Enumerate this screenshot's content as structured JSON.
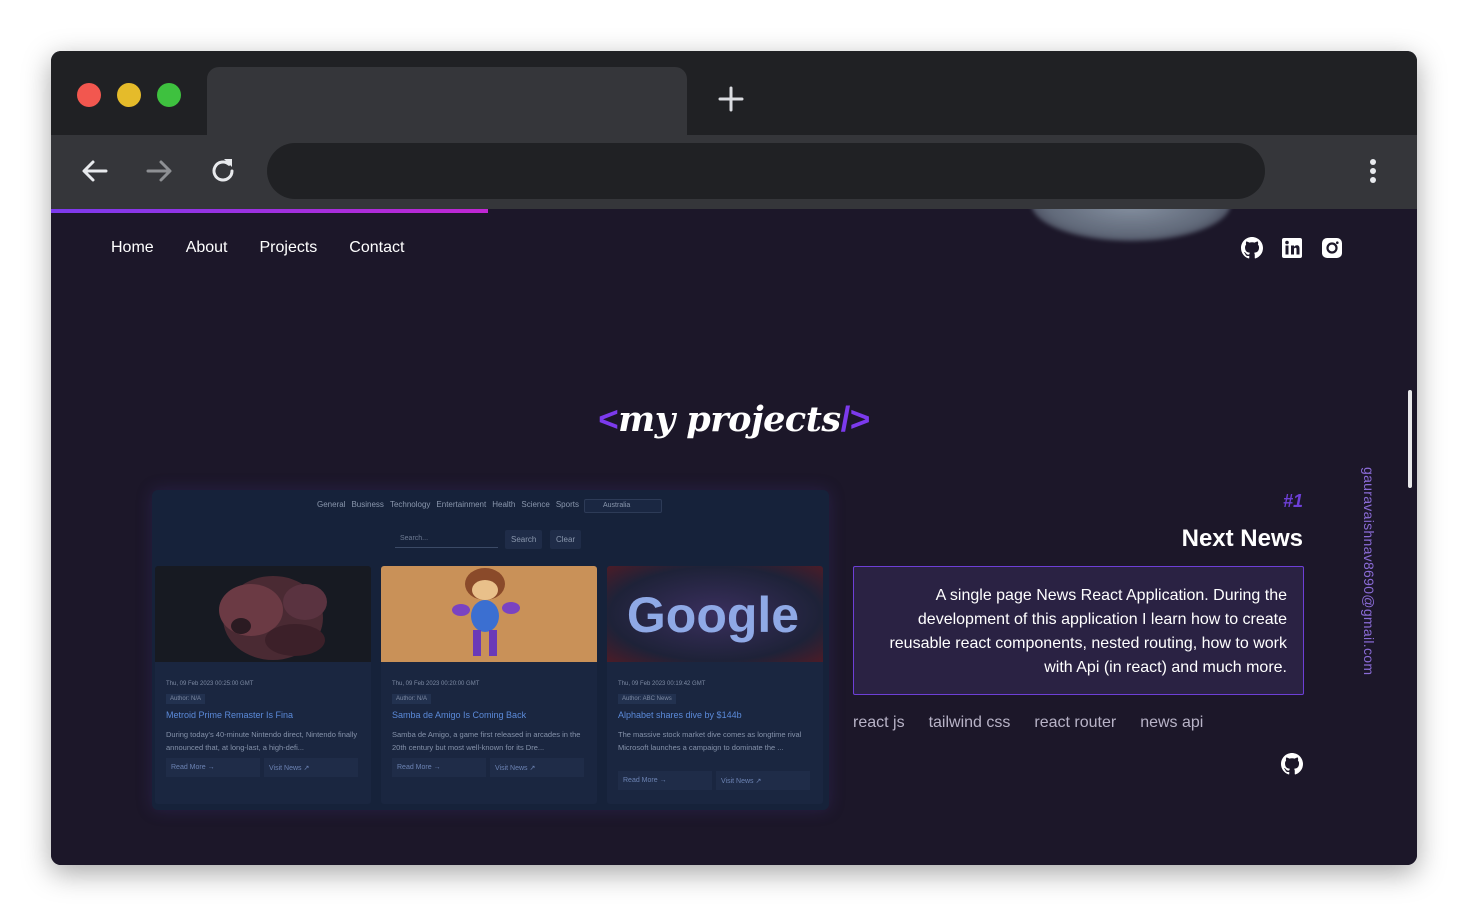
{
  "nav": {
    "items": [
      {
        "label": "Home"
      },
      {
        "label": "About"
      },
      {
        "label": "Projects"
      },
      {
        "label": "Contact"
      }
    ]
  },
  "socials": [
    "github-icon",
    "linkedin-icon",
    "instagram-icon"
  ],
  "section": {
    "bracket_open": "<",
    "title": "my projects",
    "bracket_close": "/>"
  },
  "project": {
    "number": "#1",
    "title": "Next News",
    "description": "A single page News React Application. During the development of this application I learn how to create reusable react components, nested routing, how to work with Api (in react) and much more.",
    "tech": [
      "react js",
      "tailwind css",
      "react router",
      "news api"
    ]
  },
  "screenshot": {
    "categories": [
      "General",
      "Business",
      "Technology",
      "Entertainment",
      "Health",
      "Science",
      "Sports"
    ],
    "country": "Australia",
    "search_placeholder": "Search...",
    "search_label": "Search",
    "clear_label": "Clear",
    "cards": [
      {
        "date": "Thu, 09 Feb 2023 00:25:00 GMT",
        "author": "Author: N/A",
        "title": "Metroid Prime Remaster Is Fina",
        "description": "During today's 40-minute Nintendo direct, Nintendo finally announced that, at long-last, a high-defi...",
        "read_more": "Read More →",
        "visit": "Visit News ↗"
      },
      {
        "date": "Thu, 09 Feb 2023 00:20:00 GMT",
        "author": "Author: N/A",
        "title": "Samba de Amigo Is Coming Back",
        "description": "Samba de Amigo, a game first released in arcades in the 20th century but most well-known for its Dre...",
        "read_more": "Read More →",
        "visit": "Visit News ↗"
      },
      {
        "date": "Thu, 09 Feb 2023 00:19:42 GMT",
        "author": "Author: ABC News",
        "title": "Alphabet shares dive by $144b",
        "description": "The massive stock market dive comes as longtime rival Microsoft launches a campaign to dominate the ...",
        "read_more": "Read More →",
        "visit": "Visit News ↗",
        "image_text": "Google"
      }
    ]
  },
  "email": "gauravaishnav8690@gmail.com",
  "colors": {
    "page_bg": "#1c1729",
    "accent": "#7c3aed",
    "accent_pink": "#c026d3",
    "desc_box_bg": "#2a2243"
  },
  "scroll_progress": 0.32
}
